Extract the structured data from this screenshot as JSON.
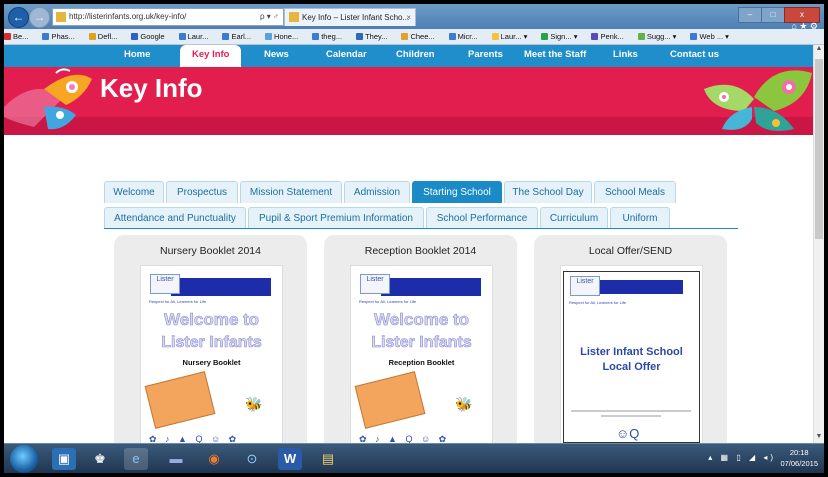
{
  "browser": {
    "url": "http://listerinfants.org.uk/key-info/",
    "address_controls": "ρ ▾ ♂",
    "tab_title": "Key Info – Lister Infant Scho...",
    "tab_close": "×",
    "back": "←",
    "forward": "→",
    "window_controls": [
      "–",
      "□",
      "x"
    ],
    "tool_icons": "⌂ ★ ⚙",
    "favorites": [
      {
        "label": "Be...",
        "color": "#d62d2d"
      },
      {
        "label": "Phas...",
        "color": "#3a7bd5"
      },
      {
        "label": "Defl...",
        "color": "#e0a21e"
      },
      {
        "label": "Google",
        "color": "#2a64c9"
      },
      {
        "label": "Laur...",
        "color": "#3a7bd5"
      },
      {
        "label": "Earl...",
        "color": "#3a7bd5"
      },
      {
        "label": "Hone...",
        "color": "#5aa0dd"
      },
      {
        "label": "theg...",
        "color": "#3a7bd5"
      },
      {
        "label": "They...",
        "color": "#2d6bb8"
      },
      {
        "label": "Chee...",
        "color": "#e2a22a"
      },
      {
        "label": "Micr...",
        "color": "#3a7bd5"
      },
      {
        "label": "Laur... ▾",
        "color": "#f2c43c"
      },
      {
        "label": "Sign... ▾",
        "color": "#2aa14a"
      },
      {
        "label": "Penk...",
        "color": "#5a48c2"
      },
      {
        "label": "Sugg... ▾",
        "color": "#62b24a"
      },
      {
        "label": "Web ... ▾",
        "color": "#3a7bd5"
      }
    ]
  },
  "site": {
    "nav": [
      "Home",
      "Key Info",
      "News",
      "Calendar",
      "Children",
      "Parents",
      "Meet the Staff",
      "Links",
      "Contact us"
    ],
    "active_nav": "Key Info",
    "banner_title": "Key Info",
    "accent": "#e21e4f",
    "nav_color": "#1f8ecb",
    "tabs_row1": [
      "Welcome",
      "Prospectus",
      "Mission Statement",
      "Admission",
      "Starting School",
      "The School Day",
      "School Meals"
    ],
    "tabs_row2": [
      "Attendance and Punctuality",
      "Pupil & Sport Premium Information",
      "School Performance",
      "Curriculum",
      "Uniform"
    ],
    "active_tab": "Starting School"
  },
  "cards": [
    {
      "title": "Nursery Booklet 2014",
      "logo": "Lister",
      "motto": "Respect for All, Learners for Life",
      "line1": "Welcome to",
      "line2": "Lister Infants",
      "subtitle": "Nursery Booklet",
      "bee": "🐝",
      "icons": "✿ ♪ ▲ Q ☺ ✿"
    },
    {
      "title": "Reception Booklet 2014",
      "logo": "Lister",
      "motto": "Respect for All, Learners for Life",
      "line1": "Welcome to",
      "line2": "Lister Infants",
      "subtitle": "Reception Booklet",
      "bee": "🐝",
      "icons": "✿ ♪ ▲ Q ☺ ✿"
    },
    {
      "title": "Local Offer/SEND",
      "logo": "Lister",
      "motto": "Respect for All, Learners for Life",
      "line1": "Lister Infant School",
      "line2": "Local Offer",
      "emblem": "☺Q"
    }
  ],
  "taskbar": {
    "apps": [
      "▣",
      "♚",
      "e",
      "▬",
      "◉",
      "⊙",
      "W",
      "▤"
    ],
    "tray": "▴ ▦ ▯ ◢ ◂)",
    "time": "20:18",
    "date": "07/06/2015"
  }
}
